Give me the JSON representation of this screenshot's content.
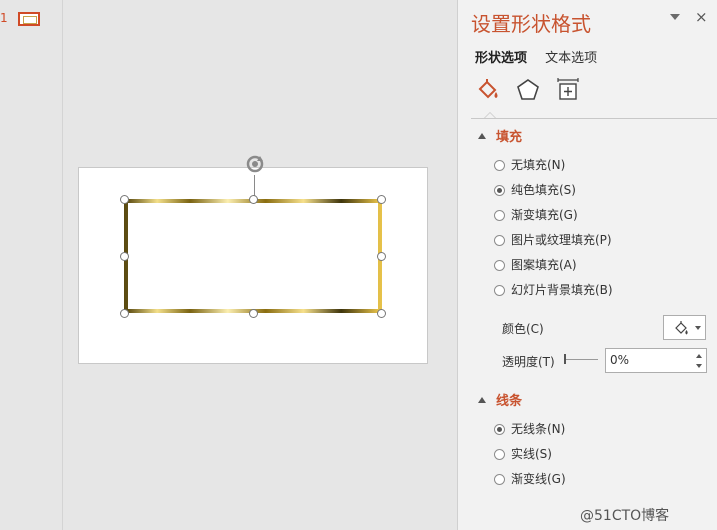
{
  "thumbnails": {
    "slide_number": "1"
  },
  "pane": {
    "title": "设置形状格式",
    "close_label": "×",
    "tabs": [
      {
        "label": "形状选项"
      },
      {
        "label": "文本选项"
      }
    ],
    "icons": [
      "fill-line-icon",
      "effects-icon",
      "size-properties-icon"
    ],
    "fill": {
      "title": "填充",
      "options": [
        {
          "label": "无填充(N)",
          "selected": false
        },
        {
          "label": "纯色填充(S)",
          "selected": true
        },
        {
          "label": "渐变填充(G)",
          "selected": false
        },
        {
          "label": "图片或纹理填充(P)",
          "selected": false
        },
        {
          "label": "图案填充(A)",
          "selected": false
        },
        {
          "label": "幻灯片背景填充(B)",
          "selected": false
        }
      ],
      "color_label": "颜色(C)",
      "transparency_label": "透明度(T)",
      "transparency_value": "0%"
    },
    "line": {
      "title": "线条",
      "options": [
        {
          "label": "无线条(N)",
          "selected": true
        },
        {
          "label": "实线(S)",
          "selected": false
        },
        {
          "label": "渐变线(G)",
          "selected": false
        }
      ]
    }
  },
  "watermark": "@51CTO博客",
  "colors": {
    "accent": "#c8532f",
    "pane_bg": "#f2f2f2",
    "canvas_bg": "#e6e6e6",
    "shape_border_gold": "#c9a431"
  }
}
